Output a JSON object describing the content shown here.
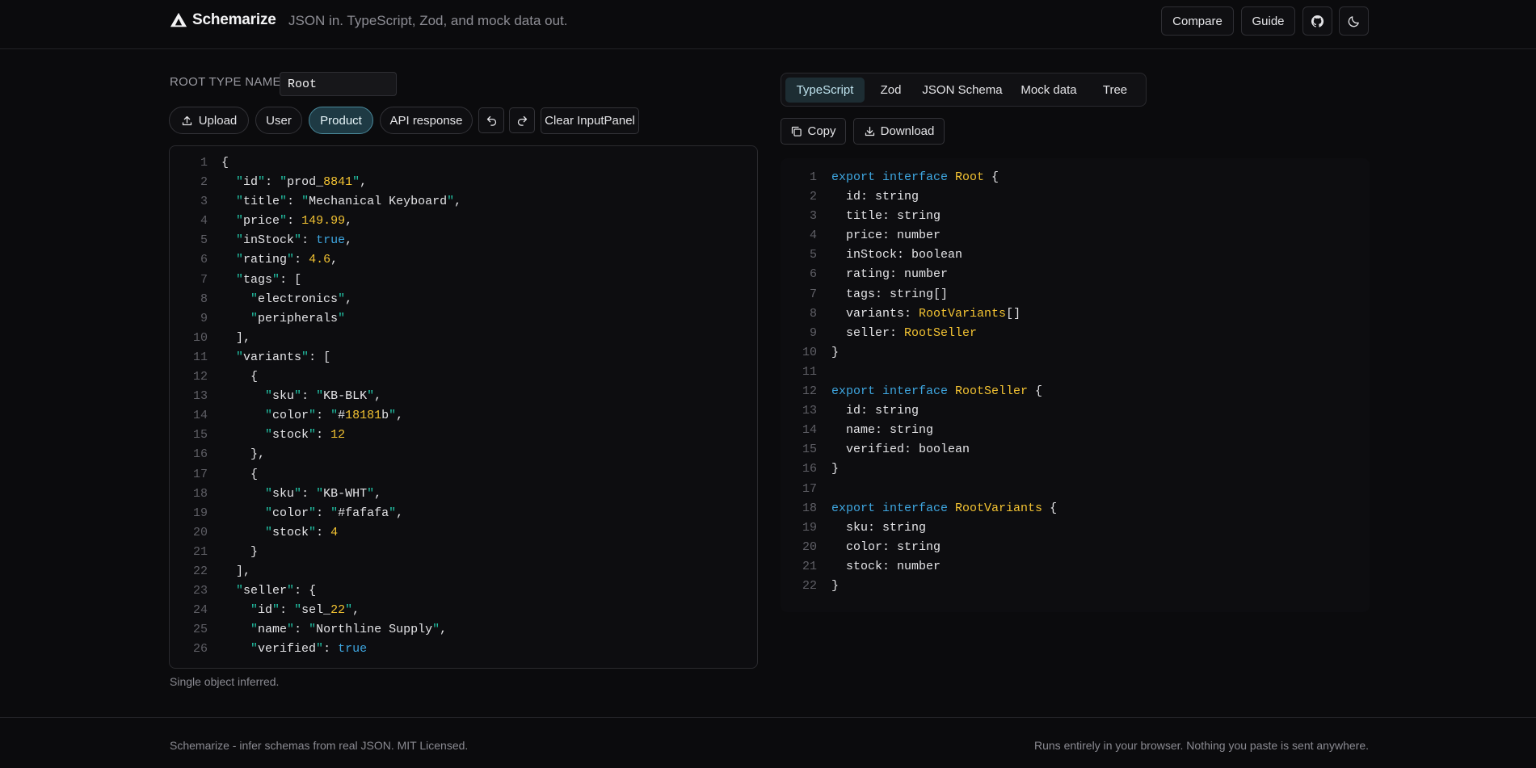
{
  "header": {
    "brand": "Schemarize",
    "tagline": "JSON in. TypeScript, Zod, and mock data out.",
    "compare_label": "Compare",
    "guide_label": "Guide",
    "github_icon": "github-icon",
    "theme_icon": "moon-icon"
  },
  "input_panel": {
    "root_type_label": "ROOT TYPE NAME",
    "root_type_value": "Root",
    "upload_label": "Upload",
    "samples": [
      "User",
      "Product",
      "API response"
    ],
    "active_sample": "Product",
    "clear_label": "Clear InputPanel",
    "status": "Single object inferred.",
    "lines": [
      {
        "n": "1",
        "t": [
          [
            "p",
            "{"
          ]
        ]
      },
      {
        "n": "2",
        "t": [
          [
            "p",
            "  "
          ],
          [
            "q",
            "\""
          ],
          [
            "p",
            "id"
          ],
          [
            "q",
            "\""
          ],
          [
            "p",
            ": "
          ],
          [
            "q",
            "\""
          ],
          [
            "p",
            "prod_"
          ],
          [
            "y",
            "8841"
          ],
          [
            "q",
            "\""
          ],
          [
            "p",
            ","
          ]
        ]
      },
      {
        "n": "3",
        "t": [
          [
            "p",
            "  "
          ],
          [
            "q",
            "\""
          ],
          [
            "p",
            "title"
          ],
          [
            "q",
            "\""
          ],
          [
            "p",
            ": "
          ],
          [
            "q",
            "\""
          ],
          [
            "p",
            "Mechanical Keyboard"
          ],
          [
            "q",
            "\""
          ],
          [
            "p",
            ","
          ]
        ]
      },
      {
        "n": "4",
        "t": [
          [
            "p",
            "  "
          ],
          [
            "q",
            "\""
          ],
          [
            "p",
            "price"
          ],
          [
            "q",
            "\""
          ],
          [
            "p",
            ": "
          ],
          [
            "y",
            "149.99"
          ],
          [
            "p",
            ","
          ]
        ]
      },
      {
        "n": "5",
        "t": [
          [
            "p",
            "  "
          ],
          [
            "q",
            "\""
          ],
          [
            "p",
            "inStock"
          ],
          [
            "q",
            "\""
          ],
          [
            "p",
            ": "
          ],
          [
            "b",
            "true"
          ],
          [
            "p",
            ","
          ]
        ]
      },
      {
        "n": "6",
        "t": [
          [
            "p",
            "  "
          ],
          [
            "q",
            "\""
          ],
          [
            "p",
            "rating"
          ],
          [
            "q",
            "\""
          ],
          [
            "p",
            ": "
          ],
          [
            "y",
            "4.6"
          ],
          [
            "p",
            ","
          ]
        ]
      },
      {
        "n": "7",
        "t": [
          [
            "p",
            "  "
          ],
          [
            "q",
            "\""
          ],
          [
            "p",
            "tags"
          ],
          [
            "q",
            "\""
          ],
          [
            "p",
            ": ["
          ]
        ]
      },
      {
        "n": "8",
        "t": [
          [
            "p",
            "    "
          ],
          [
            "q",
            "\""
          ],
          [
            "p",
            "electronics"
          ],
          [
            "q",
            "\""
          ],
          [
            "p",
            ","
          ]
        ]
      },
      {
        "n": "9",
        "t": [
          [
            "p",
            "    "
          ],
          [
            "q",
            "\""
          ],
          [
            "p",
            "peripherals"
          ],
          [
            "q",
            "\""
          ]
        ]
      },
      {
        "n": "10",
        "t": [
          [
            "p",
            "  ],"
          ]
        ]
      },
      {
        "n": "11",
        "t": [
          [
            "p",
            "  "
          ],
          [
            "q",
            "\""
          ],
          [
            "p",
            "variants"
          ],
          [
            "q",
            "\""
          ],
          [
            "p",
            ": ["
          ]
        ]
      },
      {
        "n": "12",
        "t": [
          [
            "p",
            "    {"
          ]
        ]
      },
      {
        "n": "13",
        "t": [
          [
            "p",
            "      "
          ],
          [
            "q",
            "\""
          ],
          [
            "p",
            "sku"
          ],
          [
            "q",
            "\""
          ],
          [
            "p",
            ": "
          ],
          [
            "q",
            "\""
          ],
          [
            "p",
            "KB-BLK"
          ],
          [
            "q",
            "\""
          ],
          [
            "p",
            ","
          ]
        ]
      },
      {
        "n": "14",
        "t": [
          [
            "p",
            "      "
          ],
          [
            "q",
            "\""
          ],
          [
            "p",
            "color"
          ],
          [
            "q",
            "\""
          ],
          [
            "p",
            ": "
          ],
          [
            "q",
            "\""
          ],
          [
            "p",
            "#"
          ],
          [
            "y",
            "18181"
          ],
          [
            "p",
            "b"
          ],
          [
            "q",
            "\""
          ],
          [
            "p",
            ","
          ]
        ]
      },
      {
        "n": "15",
        "t": [
          [
            "p",
            "      "
          ],
          [
            "q",
            "\""
          ],
          [
            "p",
            "stock"
          ],
          [
            "q",
            "\""
          ],
          [
            "p",
            ": "
          ],
          [
            "y",
            "12"
          ]
        ]
      },
      {
        "n": "16",
        "t": [
          [
            "p",
            "    },"
          ]
        ]
      },
      {
        "n": "17",
        "t": [
          [
            "p",
            "    {"
          ]
        ]
      },
      {
        "n": "18",
        "t": [
          [
            "p",
            "      "
          ],
          [
            "q",
            "\""
          ],
          [
            "p",
            "sku"
          ],
          [
            "q",
            "\""
          ],
          [
            "p",
            ": "
          ],
          [
            "q",
            "\""
          ],
          [
            "p",
            "KB-WHT"
          ],
          [
            "q",
            "\""
          ],
          [
            "p",
            ","
          ]
        ]
      },
      {
        "n": "19",
        "t": [
          [
            "p",
            "      "
          ],
          [
            "q",
            "\""
          ],
          [
            "p",
            "color"
          ],
          [
            "q",
            "\""
          ],
          [
            "p",
            ": "
          ],
          [
            "q",
            "\""
          ],
          [
            "p",
            "#fafafa"
          ],
          [
            "q",
            "\""
          ],
          [
            "p",
            ","
          ]
        ]
      },
      {
        "n": "20",
        "t": [
          [
            "p",
            "      "
          ],
          [
            "q",
            "\""
          ],
          [
            "p",
            "stock"
          ],
          [
            "q",
            "\""
          ],
          [
            "p",
            ": "
          ],
          [
            "y",
            "4"
          ]
        ]
      },
      {
        "n": "21",
        "t": [
          [
            "p",
            "    }"
          ]
        ]
      },
      {
        "n": "22",
        "t": [
          [
            "p",
            "  ],"
          ]
        ]
      },
      {
        "n": "23",
        "t": [
          [
            "p",
            "  "
          ],
          [
            "q",
            "\""
          ],
          [
            "p",
            "seller"
          ],
          [
            "q",
            "\""
          ],
          [
            "p",
            ": {"
          ]
        ]
      },
      {
        "n": "24",
        "t": [
          [
            "p",
            "    "
          ],
          [
            "q",
            "\""
          ],
          [
            "p",
            "id"
          ],
          [
            "q",
            "\""
          ],
          [
            "p",
            ": "
          ],
          [
            "q",
            "\""
          ],
          [
            "p",
            "sel_"
          ],
          [
            "y",
            "22"
          ],
          [
            "q",
            "\""
          ],
          [
            "p",
            ","
          ]
        ]
      },
      {
        "n": "25",
        "t": [
          [
            "p",
            "    "
          ],
          [
            "q",
            "\""
          ],
          [
            "p",
            "name"
          ],
          [
            "q",
            "\""
          ],
          [
            "p",
            ": "
          ],
          [
            "q",
            "\""
          ],
          [
            "p",
            "Northline Supply"
          ],
          [
            "q",
            "\""
          ],
          [
            "p",
            ","
          ]
        ]
      },
      {
        "n": "26",
        "t": [
          [
            "p",
            "    "
          ],
          [
            "q",
            "\""
          ],
          [
            "p",
            "verified"
          ],
          [
            "q",
            "\""
          ],
          [
            "p",
            ": "
          ],
          [
            "b",
            "true"
          ]
        ]
      }
    ]
  },
  "output_panel": {
    "tabs": [
      "TypeScript",
      "Zod",
      "JSON Schema",
      "Mock data",
      "Tree"
    ],
    "active_tab": "TypeScript",
    "copy_label": "Copy",
    "download_label": "Download",
    "lines": [
      {
        "n": "1",
        "t": [
          [
            "k",
            "export interface "
          ],
          [
            "y",
            "Root"
          ],
          [
            "p",
            " {"
          ]
        ]
      },
      {
        "n": "2",
        "t": [
          [
            "p",
            "  id: string"
          ]
        ]
      },
      {
        "n": "3",
        "t": [
          [
            "p",
            "  title: string"
          ]
        ]
      },
      {
        "n": "4",
        "t": [
          [
            "p",
            "  price: number"
          ]
        ]
      },
      {
        "n": "5",
        "t": [
          [
            "p",
            "  inStock: boolean"
          ]
        ]
      },
      {
        "n": "6",
        "t": [
          [
            "p",
            "  rating: number"
          ]
        ]
      },
      {
        "n": "7",
        "t": [
          [
            "p",
            "  tags: string[]"
          ]
        ]
      },
      {
        "n": "8",
        "t": [
          [
            "p",
            "  variants: "
          ],
          [
            "y",
            "RootVariants"
          ],
          [
            "p",
            "[]"
          ]
        ]
      },
      {
        "n": "9",
        "t": [
          [
            "p",
            "  seller: "
          ],
          [
            "y",
            "RootSeller"
          ]
        ]
      },
      {
        "n": "10",
        "t": [
          [
            "p",
            "}"
          ]
        ]
      },
      {
        "n": "11",
        "t": []
      },
      {
        "n": "12",
        "t": [
          [
            "k",
            "export interface "
          ],
          [
            "y",
            "RootSeller"
          ],
          [
            "p",
            " {"
          ]
        ]
      },
      {
        "n": "13",
        "t": [
          [
            "p",
            "  id: string"
          ]
        ]
      },
      {
        "n": "14",
        "t": [
          [
            "p",
            "  name: string"
          ]
        ]
      },
      {
        "n": "15",
        "t": [
          [
            "p",
            "  verified: boolean"
          ]
        ]
      },
      {
        "n": "16",
        "t": [
          [
            "p",
            "}"
          ]
        ]
      },
      {
        "n": "17",
        "t": []
      },
      {
        "n": "18",
        "t": [
          [
            "k",
            "export interface "
          ],
          [
            "y",
            "RootVariants"
          ],
          [
            "p",
            " {"
          ]
        ]
      },
      {
        "n": "19",
        "t": [
          [
            "p",
            "  sku: string"
          ]
        ]
      },
      {
        "n": "20",
        "t": [
          [
            "p",
            "  color: string"
          ]
        ]
      },
      {
        "n": "21",
        "t": [
          [
            "p",
            "  stock: number"
          ]
        ]
      },
      {
        "n": "22",
        "t": [
          [
            "p",
            "}"
          ]
        ]
      }
    ]
  },
  "footer": {
    "left": "Schemarize - infer schemas from real JSON. MIT Licensed.",
    "right": "Runs entirely in your browser. Nothing you paste is sent anywhere."
  },
  "colors": {
    "background": "#0b0b0d",
    "keyword": "#3ea6e0",
    "type": "#f2c232",
    "quote": "#22c3a6",
    "active_pill": "#1e3a44"
  }
}
